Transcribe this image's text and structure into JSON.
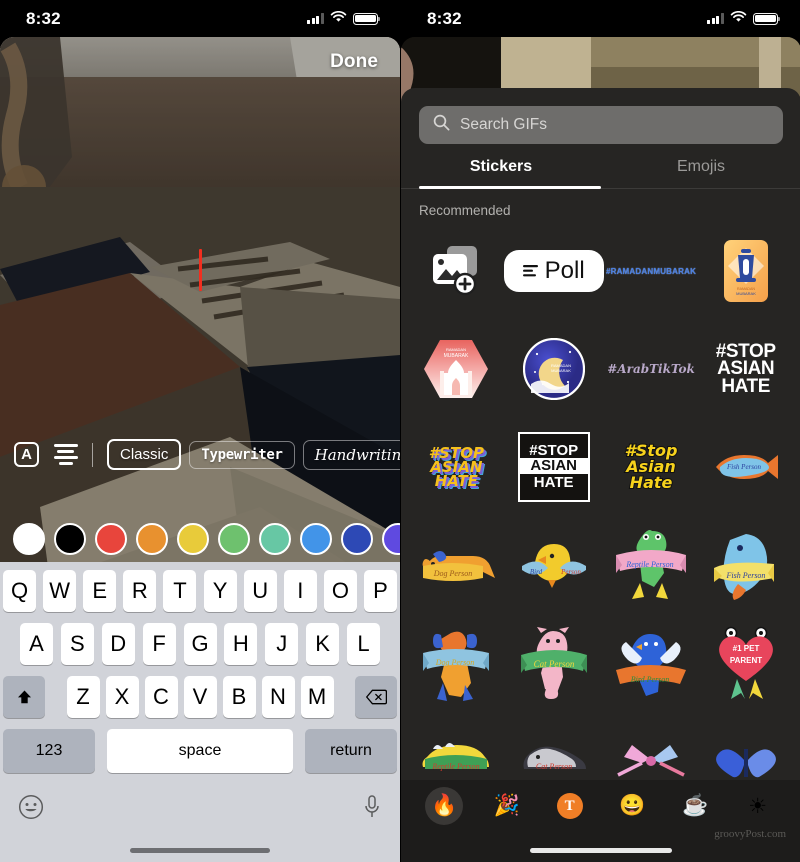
{
  "left": {
    "statusbar": {
      "time": "8:32",
      "signal_icon": "cellular-signal-icon",
      "wifi_icon": "wifi-icon",
      "battery_icon": "battery-icon"
    },
    "done_label": "Done",
    "toolbar": {
      "letter_style_icon": "letter-a-box-icon",
      "letter_label": "A",
      "align_icon": "text-align-icon",
      "fonts": [
        {
          "label": "Classic",
          "style": "classic",
          "active": true
        },
        {
          "label": "Typewriter",
          "style": "typewriter",
          "active": false
        },
        {
          "label": "Handwriting",
          "style": "handwriting",
          "active": false
        }
      ]
    },
    "colors": [
      {
        "name": "white",
        "hex": "#ffffff"
      },
      {
        "name": "black",
        "hex": "#000000"
      },
      {
        "name": "red",
        "hex": "#e8453c"
      },
      {
        "name": "orange",
        "hex": "#e8912f"
      },
      {
        "name": "yellow",
        "hex": "#e8cb3a"
      },
      {
        "name": "green",
        "hex": "#6ec16e"
      },
      {
        "name": "mint",
        "hex": "#67c7a4"
      },
      {
        "name": "blue",
        "hex": "#4294e8"
      },
      {
        "name": "navy",
        "hex": "#2d49b5"
      },
      {
        "name": "purple",
        "hex": "#5f4ae0"
      }
    ],
    "keyboard": {
      "row1": [
        "Q",
        "W",
        "E",
        "R",
        "T",
        "Y",
        "U",
        "I",
        "O",
        "P"
      ],
      "row2": [
        "A",
        "S",
        "D",
        "F",
        "G",
        "H",
        "J",
        "K",
        "L"
      ],
      "row3": [
        "Z",
        "X",
        "C",
        "V",
        "B",
        "N",
        "M"
      ],
      "shift_icon": "shift-arrow-icon",
      "backspace_icon": "backspace-icon",
      "numbers_label": "123",
      "space_label": "space",
      "return_label": "return",
      "emoji_icon": "emoji-smiley-icon",
      "mic_icon": "microphone-icon"
    }
  },
  "right": {
    "statusbar": {
      "time": "8:32",
      "signal_icon": "cellular-signal-icon",
      "wifi_icon": "wifi-icon",
      "battery_icon": "battery-icon"
    },
    "search": {
      "placeholder": "Search GIFs",
      "icon": "search-icon"
    },
    "tabs": [
      {
        "label": "Stickers",
        "active": true
      },
      {
        "label": "Emojis",
        "active": false
      }
    ],
    "section_title": "Recommended",
    "stickers": [
      {
        "name": "add-photo-sticker",
        "kind": "photo",
        "label": ""
      },
      {
        "name": "poll-sticker",
        "kind": "poll",
        "label": "Poll"
      },
      {
        "name": "ramadan-mubarak-hashtag-sticker",
        "kind": "ramhash",
        "label": "#RAMADANMUBARAK"
      },
      {
        "name": "ramadan-lantern-sticker",
        "kind": "lantern",
        "label": ""
      },
      {
        "name": "ramadan-mosque-hex-sticker",
        "kind": "mosque",
        "label": "RAMADAN MUBARAK"
      },
      {
        "name": "ramadan-moon-circle-sticker",
        "kind": "moon",
        "label": "RAMADAN MUBARAK"
      },
      {
        "name": "arab-tiktok-hashtag-sticker",
        "kind": "arab",
        "label": "#ArabTikTok"
      },
      {
        "name": "stop-asian-hate-white-sticker",
        "kind": "stopwhite",
        "label": "#STOP ASIAN HATE"
      },
      {
        "name": "stop-asian-hate-retro-sticker",
        "kind": "stop1",
        "label": "#STOP ASIAN HATE"
      },
      {
        "name": "stop-asian-hate-boxed-sticker",
        "kind": "stopbox",
        "label": "#STOP ASIAN HATE"
      },
      {
        "name": "stop-asian-hate-yellow-sticker",
        "kind": "stop3",
        "label": "#Stop Asian Hate"
      },
      {
        "name": "fish-person-sticker-1",
        "kind": "fish1",
        "label": "Fish Person"
      },
      {
        "name": "dog-person-sticker-1",
        "kind": "dog1",
        "label": "Dog Person"
      },
      {
        "name": "bird-person-sticker-1",
        "kind": "bird1",
        "label": "Bird Person"
      },
      {
        "name": "reptile-person-sticker-1",
        "kind": "rept1",
        "label": "Reptile Person"
      },
      {
        "name": "fish-person-sticker-2",
        "kind": "fish2",
        "label": "Fish Person"
      },
      {
        "name": "dog-person-sticker-2",
        "kind": "dog2",
        "label": "Dog Person"
      },
      {
        "name": "cat-person-sticker-1",
        "kind": "cat1",
        "label": "Cat Person"
      },
      {
        "name": "bird-person-sticker-2",
        "kind": "bird2",
        "label": "Bird Person"
      },
      {
        "name": "pet-parent-sticker",
        "kind": "petparent",
        "label": "#1 PET PARENT"
      },
      {
        "name": "reptile-person-sticker-2",
        "kind": "rept2",
        "label": "Reptile Person"
      },
      {
        "name": "cat-person-sticker-2",
        "kind": "cat2",
        "label": "Cat Person"
      },
      {
        "name": "bow-sticker",
        "kind": "bow",
        "label": ""
      },
      {
        "name": "butterfly-sticker",
        "kind": "butterfly",
        "label": ""
      }
    ],
    "tabbar": [
      {
        "name": "trending-tab",
        "glyph": "🔥",
        "selected": true
      },
      {
        "name": "party-tab",
        "glyph": "🎉",
        "selected": false
      },
      {
        "name": "text-tab",
        "glyph": "T",
        "selected": false
      },
      {
        "name": "smileys-tab",
        "glyph": "😀",
        "selected": false
      },
      {
        "name": "food-drink-tab",
        "glyph": "☕",
        "selected": false
      },
      {
        "name": "weather-tab",
        "glyph": "☀",
        "selected": false
      }
    ],
    "watermark": "groovyPost.com"
  }
}
